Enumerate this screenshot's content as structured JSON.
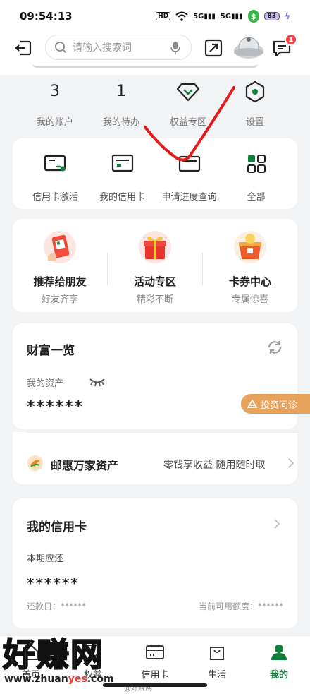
{
  "status": {
    "time": "09:54:13",
    "hd": "HD",
    "sig1": "5G",
    "sig2": "5G",
    "battery": "83"
  },
  "topbar": {
    "search_placeholder": "请输入搜索词",
    "msg_badge": "1"
  },
  "stats": [
    {
      "value": "3",
      "label": "我的账户"
    },
    {
      "value": "1",
      "label": "我的待办"
    },
    {
      "icon": "diamond-icon",
      "label": "权益专区"
    },
    {
      "icon": "settings-hex-icon",
      "label": "设置"
    }
  ],
  "quick": [
    {
      "icon": "card-activate-icon",
      "label": "信用卡激活"
    },
    {
      "icon": "my-card-icon",
      "label": "我的信用卡"
    },
    {
      "icon": "application-progress-icon",
      "label": "申请进度查询"
    },
    {
      "icon": "grid-icon",
      "label": "全部"
    }
  ],
  "promos": [
    {
      "title": "推荐给朋友",
      "sub": "好友齐享"
    },
    {
      "title": "活动专区",
      "sub": "精彩不断"
    },
    {
      "title": "卡券中心",
      "sub": "专属惊喜"
    }
  ],
  "wealth": {
    "title": "财富一览",
    "asset_label": "我的资产",
    "asset_value": "******",
    "invest_tag": "投资问诊"
  },
  "fund": {
    "name": "邮惠万家资产",
    "slogan": "零钱享收益 随用随时取"
  },
  "credit": {
    "title": "我的信用卡",
    "due_label": "本期应还",
    "due_value": "******",
    "repay": "还款日：******",
    "limit": "当前可用额度：******"
  },
  "tabs": [
    {
      "label": "首页",
      "icon": "home-icon"
    },
    {
      "label": "权益",
      "icon": "rights-icon"
    },
    {
      "label": "信用卡",
      "icon": "credit-card-icon"
    },
    {
      "label": "生活",
      "icon": "shopping-bag-icon"
    },
    {
      "label": "我的",
      "icon": "profile-icon",
      "active": true
    }
  ],
  "watermark": {
    "big": "好赚网",
    "url_a": "www.zhuan",
    "url_b": "yes",
    "url_c": ".com",
    "weibo": "@好赚网"
  },
  "colors": {
    "brand_green": "#0f7f3c",
    "red_mark": "#e41c1c",
    "badge_red": "#f14545"
  }
}
